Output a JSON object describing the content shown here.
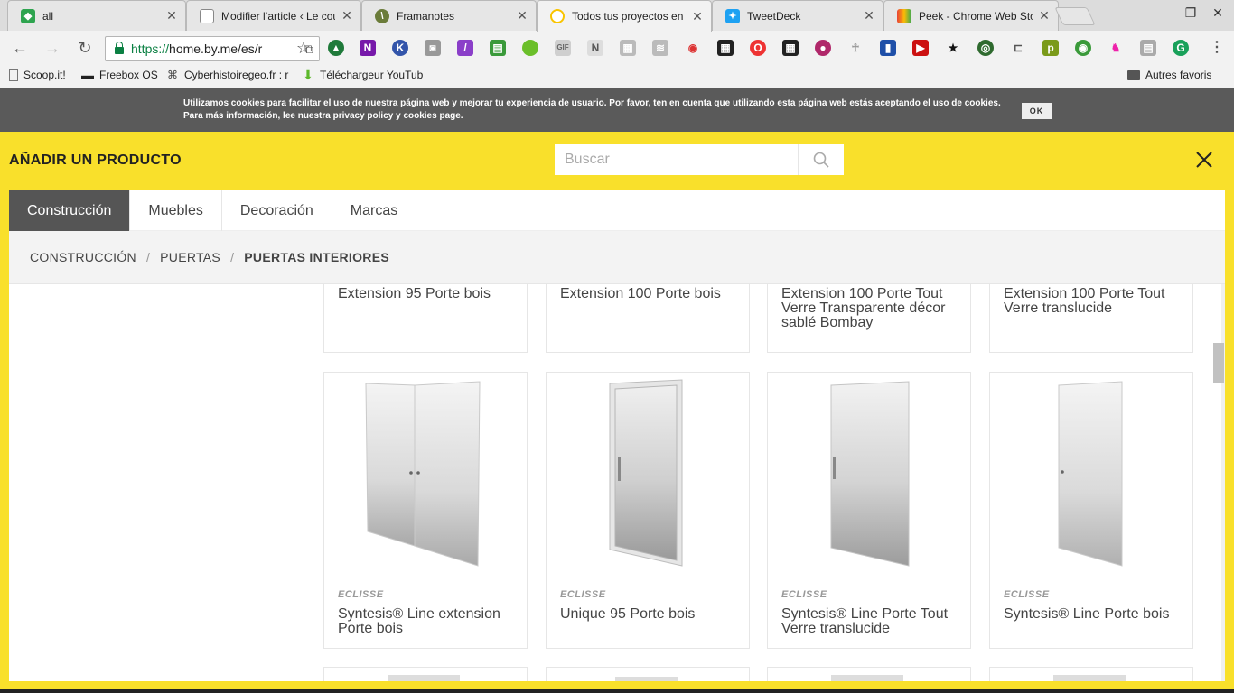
{
  "browser": {
    "tabs": [
      {
        "title": "all",
        "favicon": "diamond-icon",
        "color": "#2ea44f"
      },
      {
        "title": "Modifier l’article ‹ Le cou",
        "favicon": "page-icon",
        "color": "#888888"
      },
      {
        "title": "Framanotes",
        "favicon": "framanotes-icon",
        "color": "#6b7c3a"
      },
      {
        "title": "Todos tus proyectos en",
        "favicon": "home-icon",
        "color": "#f9e02b",
        "active": true
      },
      {
        "title": "TweetDeck",
        "favicon": "twitter-icon",
        "color": "#1da1f2"
      },
      {
        "title": "Peek - Chrome Web Sto",
        "favicon": "webstore-icon",
        "color": "#e94235"
      }
    ],
    "window_controls": {
      "minimize": "–",
      "restore": "❐",
      "close": "✕"
    },
    "url": {
      "scheme": "https://",
      "rest": "home.by.me/es/r"
    },
    "bookmarks": [
      {
        "label": "Scoop.it!",
        "icon": "page-icon"
      },
      {
        "label": "Freebox OS",
        "icon": "freebox-icon"
      },
      {
        "label": "Cyberhistoiregeo.fr : r",
        "icon": "cat-icon"
      },
      {
        "label": "Téléchargeur YouTub",
        "icon": "download-arrow-icon"
      }
    ],
    "other_bookmarks": "Autres favoris"
  },
  "cookie": {
    "text": "Utilizamos cookies para facilitar el uso de nuestra página web y mejorar tu experiencia de usuario. Por favor, ten en cuenta que utilizando esta página web estás aceptando el uso de cookies. Para más información, lee nuestra privacy policy y cookies page.",
    "ok": "OK"
  },
  "modal": {
    "title": "AÑADIR UN PRODUCTO",
    "search_placeholder": "Buscar",
    "accent": "#f9e02b"
  },
  "categories": [
    {
      "label": "Construcción",
      "active": true
    },
    {
      "label": "Muebles"
    },
    {
      "label": "Decoración"
    },
    {
      "label": "Marcas"
    }
  ],
  "breadcrumb": [
    "CONSTRUCCIÓN",
    "PUERTAS",
    "PUERTAS INTERIORES"
  ],
  "breadcrumb_sep": "/",
  "products_top_row": [
    {
      "name": "Extension 95 Porte bois"
    },
    {
      "name": "Extension 100 Porte bois"
    },
    {
      "name": "Extension 100 Porte Tout Verre Transparente décor sablé Bombay"
    },
    {
      "name": "Extension 100 Porte Tout Verre translucide"
    }
  ],
  "products_middle_row": [
    {
      "brand": "ECLISSE",
      "name": "Syntesis® Line extension Porte bois",
      "door": "double"
    },
    {
      "brand": "ECLISSE",
      "name": "Unique 95 Porte bois",
      "door": "framed"
    },
    {
      "brand": "ECLISSE",
      "name": "Syntesis® Line Porte Tout Verre translucide",
      "door": "single-handle"
    },
    {
      "brand": "ECLISSE",
      "name": "Syntesis® Line Porte bois",
      "door": "single"
    }
  ]
}
